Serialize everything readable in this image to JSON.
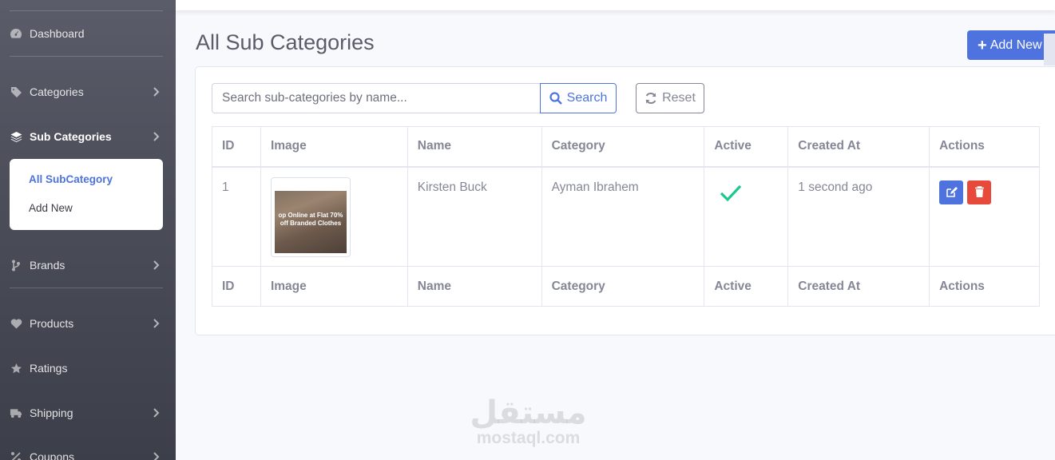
{
  "sidebar": {
    "items": [
      {
        "label": "Dashboard",
        "icon": "tachometer-icon"
      },
      {
        "label": "Categories",
        "icon": "tag-icon"
      },
      {
        "label": "Sub Categories",
        "icon": "layers-icon"
      },
      {
        "label": "Brands",
        "icon": "code-branch-icon"
      },
      {
        "label": "Products",
        "icon": "heart-icon"
      },
      {
        "label": "Ratings",
        "icon": "star-icon"
      },
      {
        "label": "Shipping",
        "icon": "truck-icon"
      },
      {
        "label": "Coupons",
        "icon": "percent-icon"
      }
    ],
    "submenu": [
      {
        "label": "All SubCategory"
      },
      {
        "label": "Add New"
      }
    ]
  },
  "header": {
    "title": "All Sub Categories",
    "add_label": "Add New"
  },
  "search": {
    "placeholder": "Search sub-categories by name...",
    "value": "",
    "search_label": "Search",
    "reset_label": "Reset"
  },
  "table": {
    "columns": [
      "ID",
      "Image",
      "Name",
      "Category",
      "Active",
      "Created At",
      "Actions"
    ],
    "rows": [
      {
        "id": "1",
        "image_text": "op Online at Flat 70% off Branded Clothes",
        "name": "Kirsten Buck",
        "category": "Ayman Ibrahem",
        "active": true,
        "created_at": "1 second ago"
      }
    ]
  },
  "watermark": {
    "arabic": "مستقل",
    "latin": "mostaql.com"
  },
  "colors": {
    "primary": "#4e73df",
    "danger": "#e74a3b",
    "success": "#1cc88a",
    "sidebar": "#4c4f5a"
  }
}
